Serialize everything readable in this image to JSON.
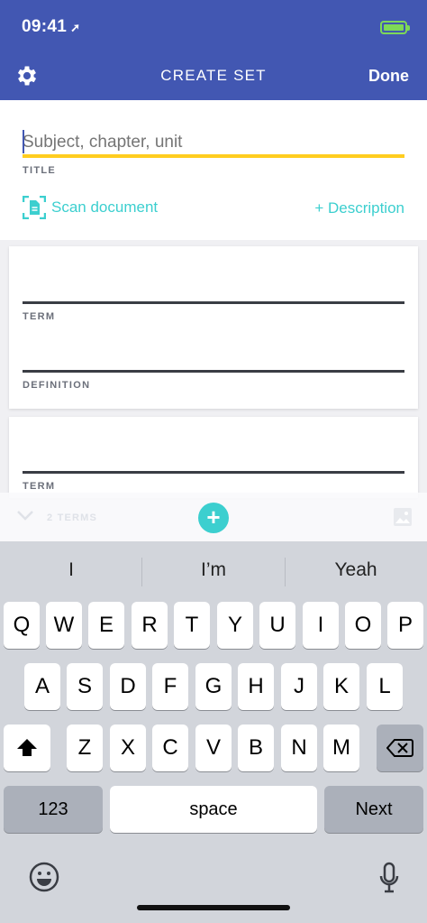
{
  "status_bar": {
    "time": "09:41",
    "location_glyph": "➚"
  },
  "nav": {
    "title": "CREATE SET",
    "done_label": "Done"
  },
  "title_field": {
    "placeholder": "Subject, chapter, unit",
    "label": "TITLE"
  },
  "actions": {
    "scan_label": "Scan document",
    "description_label": "+ Description"
  },
  "cards": [
    {
      "term_label": "TERM",
      "definition_label": "DEFINITION"
    },
    {
      "term_label": "TERM"
    }
  ],
  "accessory_bar": {
    "terms_count": "2 TERMS",
    "add_glyph": "+"
  },
  "keyboard": {
    "suggestions": [
      "I",
      "I’m",
      "Yeah"
    ],
    "row1": [
      "Q",
      "W",
      "E",
      "R",
      "T",
      "Y",
      "U",
      "I",
      "O",
      "P"
    ],
    "row2": [
      "A",
      "S",
      "D",
      "F",
      "G",
      "H",
      "J",
      "K",
      "L"
    ],
    "row3": [
      "Z",
      "X",
      "C",
      "V",
      "B",
      "N",
      "M"
    ],
    "numbers_label": "123",
    "space_label": "space",
    "next_label": "Next"
  },
  "colors": {
    "header": "#4257b2",
    "accent": "#3ccfcf",
    "title_underline": "#ffcd1f",
    "battery": "#7ed957"
  }
}
